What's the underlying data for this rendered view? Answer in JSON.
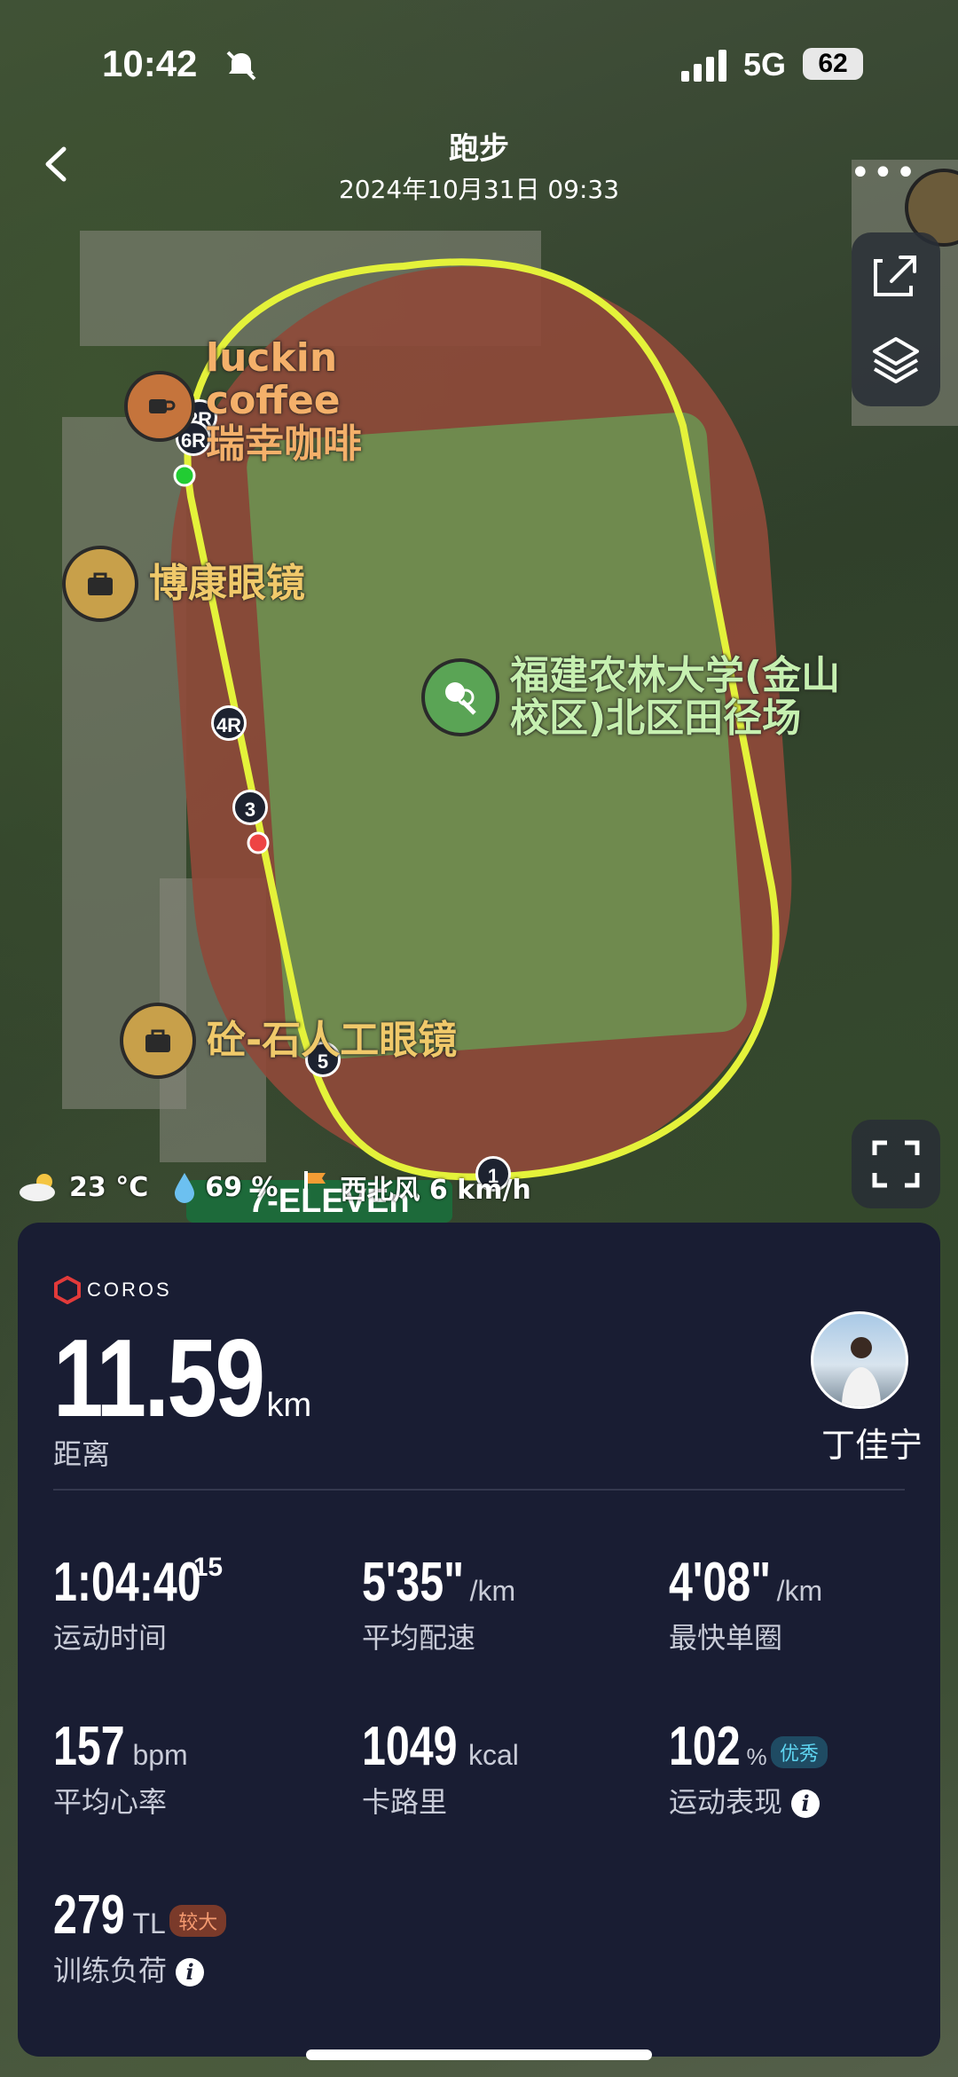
{
  "status_bar": {
    "time": "10:42",
    "network": "5G",
    "battery": "62"
  },
  "header": {
    "title": "跑步",
    "subtitle": "2024年10月31日 09:33"
  },
  "map": {
    "pois": [
      {
        "label": "luckin\ncoffee\n瑞幸咖啡",
        "icon": "coffee-cup-icon"
      },
      {
        "label": "博康眼镜",
        "icon": "shopping-bag-icon"
      },
      {
        "label": "福建农林大学(金山\n校区)北区田径场",
        "icon": "sports-icon"
      },
      {
        "label": "砼-石人工眼镜",
        "icon": "shopping-bag-icon"
      }
    ],
    "laps": [
      "2R",
      "6R",
      "4R",
      "3",
      "5",
      "1"
    ],
    "store_label": "7-ELEVEn"
  },
  "weather": {
    "temp": "23 °C",
    "humidity": "69 %",
    "wind": "西北风 6 km/h"
  },
  "card": {
    "brand": "COROS",
    "distance": {
      "value": "11.59",
      "unit": "km",
      "label": "距离"
    },
    "user": {
      "name": "丁佳宁"
    },
    "stats": {
      "time": {
        "value": "1:04:40",
        "sup": "15",
        "label": "运动时间"
      },
      "avg_pace": {
        "value": "5'35\"",
        "unit": "/km",
        "label": "平均配速"
      },
      "best_lap": {
        "value": "4'08\"",
        "unit": "/km",
        "label": "最快单圈"
      },
      "avg_hr": {
        "value": "157",
        "unit": "bpm",
        "label": "平均心率"
      },
      "calories": {
        "value": "1049",
        "unit": "kcal",
        "label": "卡路里"
      },
      "performance": {
        "value": "102",
        "unit": "%",
        "badge": "优秀",
        "label": "运动表现"
      },
      "training_load": {
        "value": "279",
        "unit": "TL",
        "badge": "较大",
        "label": "训练负荷"
      }
    }
  },
  "colors": {
    "route": "#e4f23a",
    "card_bg": "#191d33",
    "start": "#22cc33",
    "end": "#ee4444"
  }
}
